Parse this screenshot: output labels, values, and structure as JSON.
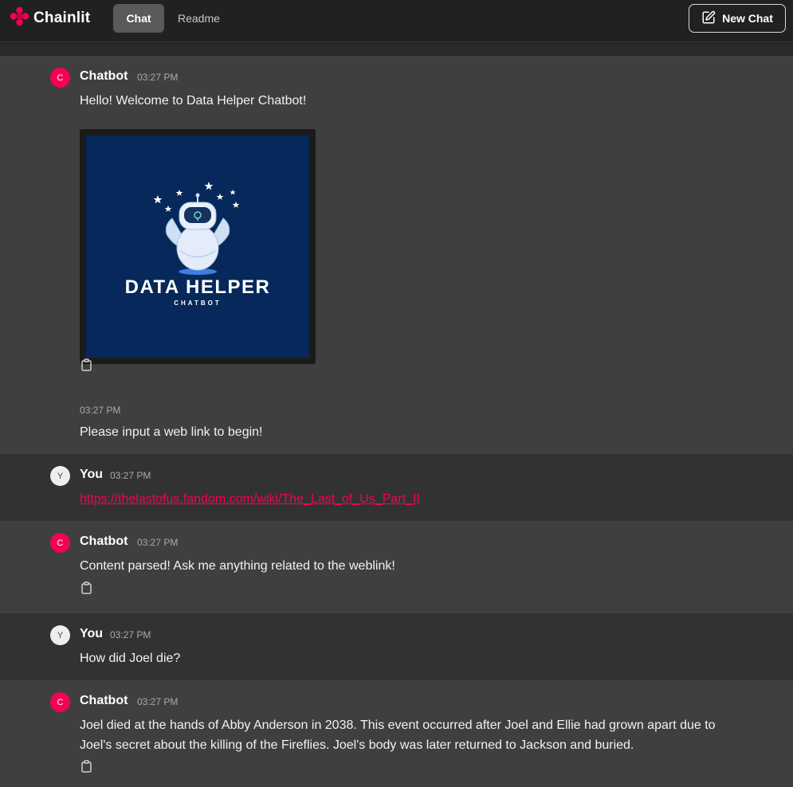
{
  "header": {
    "brand": "Chainlit",
    "tabs": [
      {
        "label": "Chat",
        "active": true
      },
      {
        "label": "Readme",
        "active": false
      }
    ],
    "new_chat_label": "New Chat"
  },
  "colors": {
    "accent": "#f50057",
    "bot_row": "#3f3f3f",
    "user_row": "#323232",
    "header": "#212121"
  },
  "messages": [
    {
      "author": "Chatbot",
      "avatar": "C",
      "time": "03:27 PM",
      "text": "Hello! Welcome to Data Helper Chatbot!",
      "image": {
        "title": "DATA HELPER",
        "subtitle": "CHATBOT"
      }
    },
    {
      "time": "03:27 PM",
      "text": "Please input a web link to begin!"
    },
    {
      "author": "You",
      "avatar": "Y",
      "time": "03:27 PM",
      "link": "https://thelastofus.fandom.com/wiki/The_Last_of_Us_Part_II"
    },
    {
      "author": "Chatbot",
      "avatar": "C",
      "time": "03:27 PM",
      "text": "Content parsed! Ask me anything related to the weblink!"
    },
    {
      "author": "You",
      "avatar": "Y",
      "time": "03:27 PM",
      "text": "How did Joel die?"
    },
    {
      "author": "Chatbot",
      "avatar": "C",
      "time": "03:27 PM",
      "text_line1": "Joel died at the hands of Abby Anderson in 2038. This event occurred after Joel and Ellie had grown apart due to",
      "text_line2": "Joel's secret about the killing of the Fireflies. Joel's body was later returned to Jackson and buried."
    }
  ],
  "icons": {
    "logo": "chainlit-logo-icon",
    "new_chat": "edit-icon",
    "copy": "clipboard-icon"
  }
}
